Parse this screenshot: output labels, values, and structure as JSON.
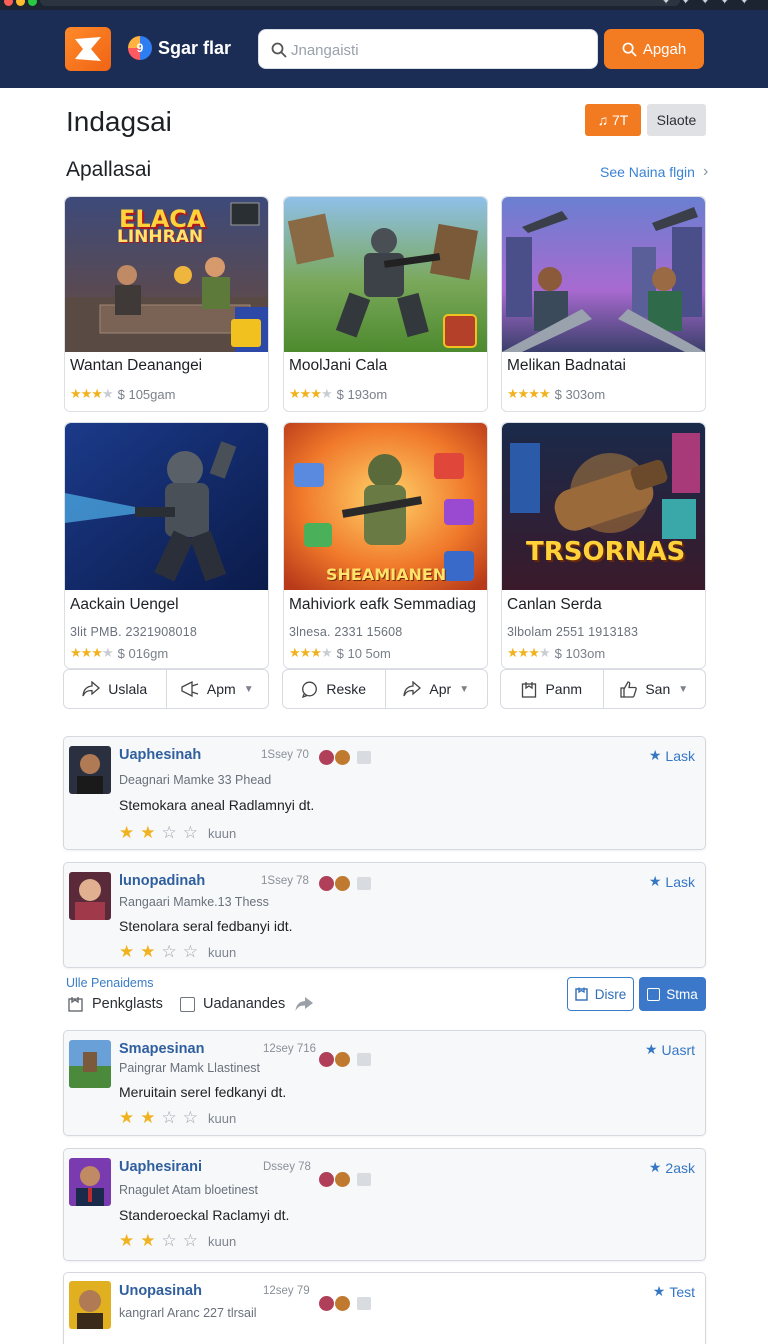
{
  "header": {
    "brand_mark": "9",
    "brand_name": "Sgar flar",
    "search_placeholder": "Jnangaisti",
    "search_button": "Apgah"
  },
  "page": {
    "title": "Indagsai",
    "btn_orange": "♫ 7T",
    "btn_grey": "Slaote"
  },
  "section": {
    "title": "Apallasai",
    "see_all": "See Naina flgin"
  },
  "cards": [
    {
      "name": "Wantan Deanangei",
      "meta": "",
      "rating_text": "$ 105gam",
      "stars": 4,
      "thumb_title": "ELACA",
      "thumb_sub": "LINHRAN"
    },
    {
      "name": "MoolJani Cala",
      "meta": "",
      "rating_text": "$ 193om",
      "stars": 4,
      "thumb_title": "",
      "thumb_sub": ""
    },
    {
      "name": "Melikan Badnatai",
      "meta": "",
      "rating_text": "$ 303om",
      "stars": 4,
      "thumb_title": "",
      "thumb_sub": ""
    },
    {
      "name": "Aackain Uengel",
      "meta": "3lit PMB. 2321908018",
      "rating_text": "$ 016gm",
      "stars": 4,
      "thumb_title": "",
      "thumb_sub": ""
    },
    {
      "name": "Mahiviork eafk Semmadiag",
      "meta": "3lnesa. 2331 15608",
      "rating_text": "$ 10 5om",
      "stars": 4,
      "thumb_title": "SHEAMIANEN",
      "thumb_sub": ""
    },
    {
      "name": "Canlan Serda",
      "meta": "3lbolam 2551 1913183",
      "rating_text": "$ 103om",
      "stars": 3,
      "thumb_title": "TRSORNAS",
      "thumb_sub": ""
    }
  ],
  "actions": [
    [
      {
        "label": "Uslala",
        "icon": "share-icon",
        "caret": false
      },
      {
        "label": "Apm",
        "icon": "megaphone-icon",
        "caret": true
      }
    ],
    [
      {
        "label": "Reske",
        "icon": "chat-icon",
        "caret": false
      },
      {
        "label": "Apr",
        "icon": "share-icon",
        "caret": true
      }
    ],
    [
      {
        "label": "Panm",
        "icon": "bookmark-icon",
        "caret": false
      },
      {
        "label": "San",
        "icon": "thumb-up-icon",
        "caret": true
      }
    ]
  ],
  "reviews": [
    {
      "name": "Uaphesinah",
      "date": "1Ssey 70",
      "sub": "Deagnari Mamke 33 Phead",
      "text": "Stemokara aneal Radlamnyi dt.",
      "stars": 2,
      "stars_label": "kuun",
      "action": "Lask"
    },
    {
      "name": "lunopadinah",
      "date": "1Ssey 78",
      "sub": "Rangaari Mamke.13 Thess",
      "text": "Stenolara seral fedbanyi idt.",
      "stars": 2,
      "stars_label": "kuun",
      "action": "Lask"
    },
    {
      "name": "Smapesinan",
      "date": "12sey 716",
      "sub": "Paingrar Mamk Llastinest",
      "text": "Meruitain serel fedkanyi dt.",
      "stars": 2,
      "stars_label": "kuun",
      "action": "Uasrt"
    },
    {
      "name": "Uaphesirani",
      "date": "Dssey 78",
      "sub": "Rnagulet Atam bloetinest",
      "text": "Standeroeckal Raclamyi dt.",
      "stars": 2,
      "stars_label": "kuun",
      "action": "2ask"
    },
    {
      "name": "Unopasinah",
      "date": "12sey 79",
      "sub": "kangrarl Aranc 227 tlrsail",
      "text": "",
      "stars": 0,
      "stars_label": "",
      "action": "Test"
    }
  ],
  "filters": {
    "label": "Ulle Penaidems",
    "checkbox1": "Penkglasts",
    "checkbox2": "Uadanandes",
    "btn_outline": "Disre",
    "btn_blue": "Stma"
  },
  "colors": {
    "header_bg": "#1b2c55",
    "accent_orange": "#f37b22",
    "link_blue": "#3b82d4",
    "star": "#f1b21f"
  }
}
